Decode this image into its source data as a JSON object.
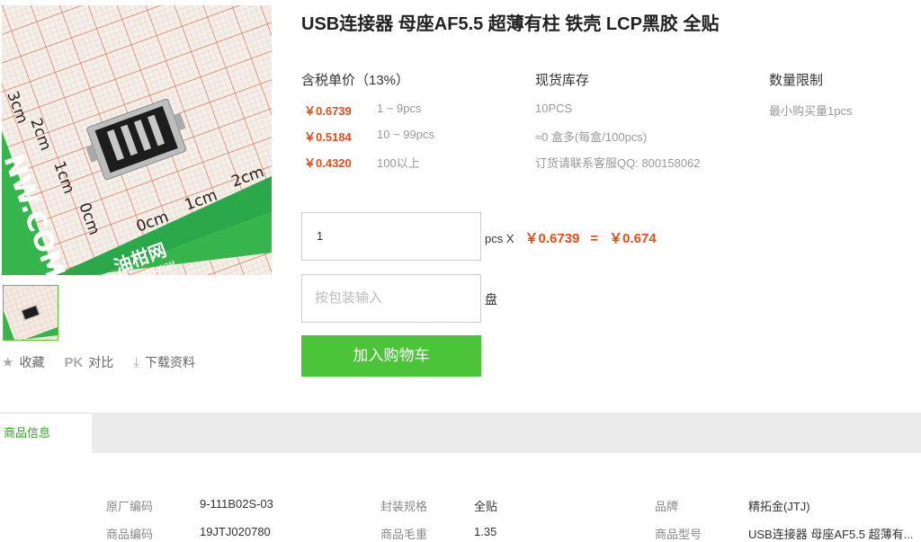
{
  "product": {
    "title": "USB连接器 母座AF5.5 超薄有柱 铁壳 LCP黑胶 全贴"
  },
  "image": {
    "ruler_labels": [
      "3cm",
      "2cm",
      "1cm",
      "0cm",
      "0cm",
      "1cm",
      "2cm"
    ],
    "watermark": "NW.COM",
    "brand_logo": "油柑网",
    "brand_sub": "YOUGANW.COM"
  },
  "actions": {
    "favorite": "收藏",
    "pk_icon": "PK",
    "compare": "对比",
    "download": "下载资料"
  },
  "pricing": {
    "header": "含税单价（13%）",
    "tiers": [
      {
        "price": "￥0.6739",
        "range": "1 ~ 9pcs"
      },
      {
        "price": "￥0.5184",
        "range": "10 ~ 99pcs"
      },
      {
        "price": "￥0.4320",
        "range": "100以上"
      }
    ]
  },
  "stock": {
    "header": "现货库存",
    "lines": [
      "10PCS",
      "≈0 盒多(每盒/100pcs)",
      "订货请联系客服QQ: 800158062"
    ]
  },
  "limit": {
    "header": "数量限制",
    "min": "最小购买量1pcs"
  },
  "order": {
    "qty_value": "1",
    "pkg_placeholder": "按包装输入",
    "unit_x": "pcs X",
    "unit_price": "￥0.6739",
    "equals": "=",
    "total": "￥0.674",
    "pkg_unit": "盘",
    "add_to_cart": "加入购物车"
  },
  "tabs": {
    "active": "商品信息"
  },
  "specs": {
    "row1": [
      {
        "label": "原厂编码",
        "value": "9-111B02S-03"
      },
      {
        "label": "封装规格",
        "value": "全贴"
      },
      {
        "label": "品牌",
        "value": "精拓金(JTJ)"
      }
    ],
    "row2": [
      {
        "label": "商品编码",
        "value": "19JTJ020780"
      },
      {
        "label": "商品毛重",
        "value": "1.35"
      },
      {
        "label": "商品型号",
        "value": "USB连接器 母座AF5.5 超薄有..."
      }
    ]
  },
  "colors": {
    "price": "#e64d19",
    "accent_green": "#4cc43a",
    "tab_green": "#3a9c2a"
  }
}
